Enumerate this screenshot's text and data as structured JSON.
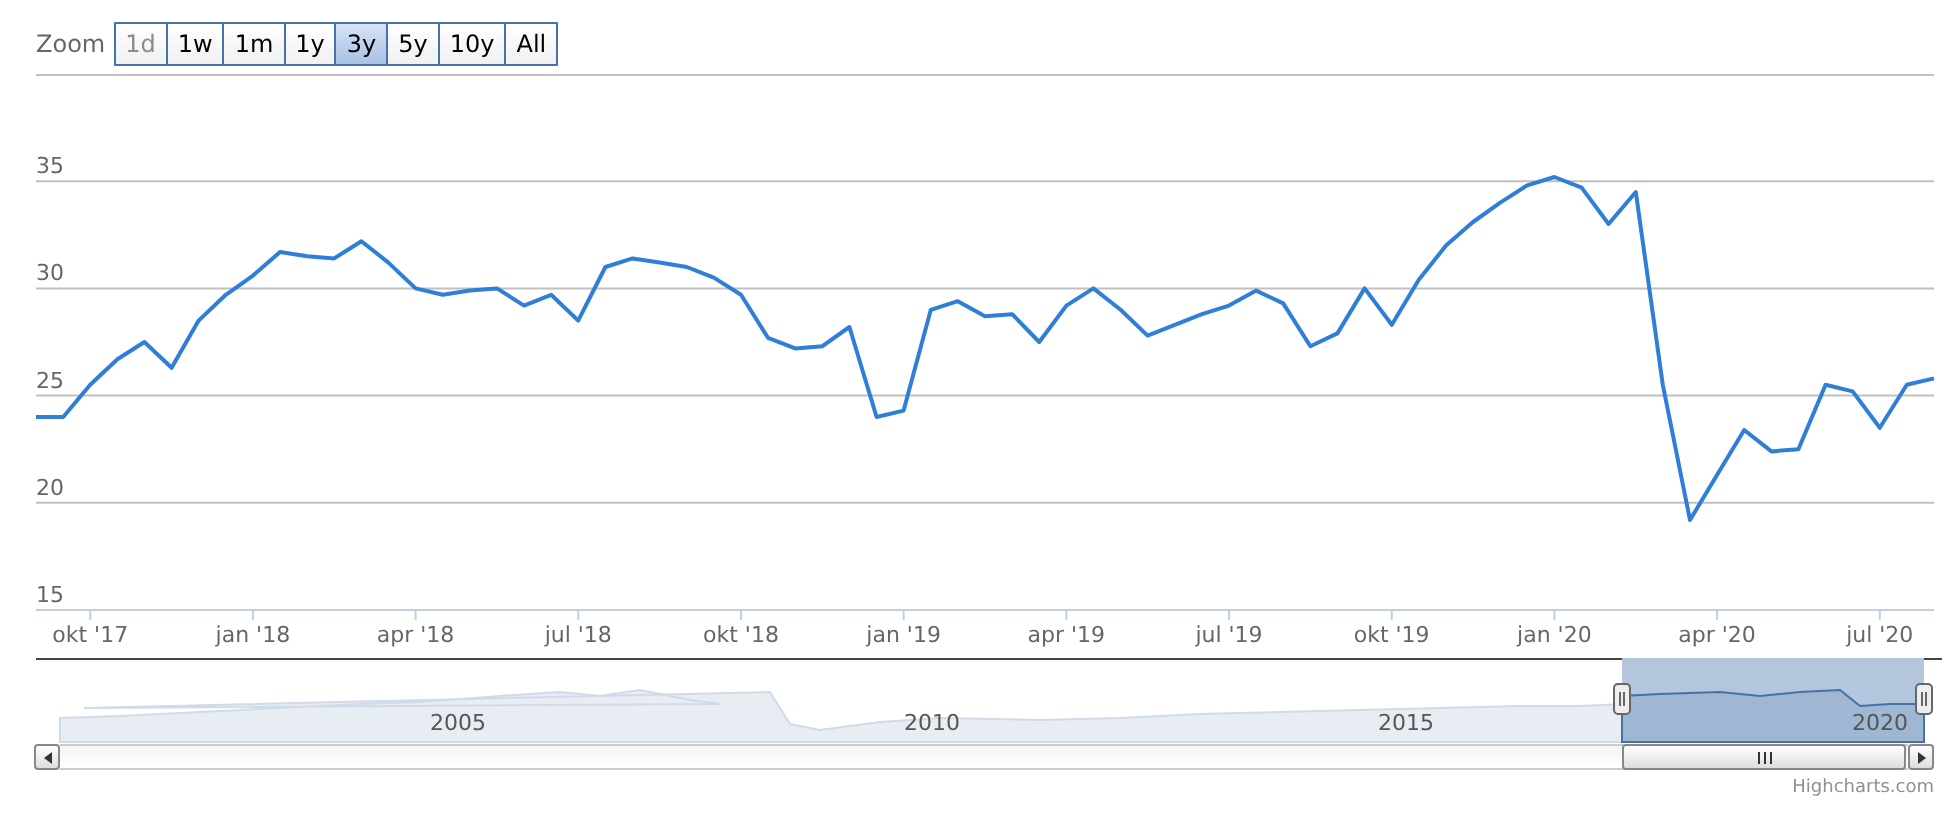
{
  "range_selector": {
    "label": "Zoom",
    "buttons": [
      {
        "label": "1d",
        "selected": false,
        "disabled": true
      },
      {
        "label": "1w",
        "selected": false,
        "disabled": false
      },
      {
        "label": "1m",
        "selected": false,
        "disabled": false
      },
      {
        "label": "1y",
        "selected": false,
        "disabled": false
      },
      {
        "label": "3y",
        "selected": true,
        "disabled": false
      },
      {
        "label": "5y",
        "selected": false,
        "disabled": false
      },
      {
        "label": "10y",
        "selected": false,
        "disabled": false
      },
      {
        "label": "All",
        "selected": false,
        "disabled": false
      }
    ]
  },
  "chart": {
    "chart_data": {
      "type": "line",
      "grid": true,
      "ylim": [
        15,
        40
      ],
      "yticks": [
        15,
        20,
        25,
        30,
        35
      ],
      "categories": [
        null,
        null,
        "okt '17",
        null,
        null,
        null,
        null,
        null,
        "jan '18",
        null,
        null,
        null,
        null,
        null,
        "apr '18",
        null,
        null,
        null,
        null,
        null,
        "jul '18",
        null,
        null,
        null,
        null,
        null,
        "okt '18",
        null,
        null,
        null,
        null,
        null,
        "jan '19",
        null,
        null,
        null,
        null,
        null,
        "apr '19",
        null,
        null,
        null,
        null,
        null,
        "jul '19",
        null,
        null,
        null,
        null,
        null,
        "okt '19",
        null,
        null,
        null,
        null,
        null,
        "jan '20",
        null,
        null,
        null,
        null,
        null,
        "apr '20",
        null,
        null,
        null,
        null,
        null,
        "jul '20",
        null,
        null
      ],
      "series": [
        {
          "color": "#2f7ed8",
          "values": [
            24,
            24,
            25.5,
            26.7,
            27.5,
            26.3,
            28.5,
            29.7,
            30.6,
            31.7,
            31.5,
            31.4,
            32.2,
            31.2,
            30,
            29.7,
            29.9,
            30,
            29.2,
            29.7,
            28.5,
            31,
            31.4,
            31.2,
            31,
            30.5,
            29.7,
            27.7,
            27.2,
            27.3,
            28.2,
            24,
            24.3,
            29,
            29.4,
            28.7,
            28.8,
            27.5,
            29.2,
            30,
            29,
            27.8,
            28.3,
            28.8,
            29.2,
            29.9,
            29.3,
            27.3,
            27.9,
            30,
            28.3,
            30.4,
            32,
            33.1,
            34,
            34.8,
            35.2,
            34.7,
            33,
            34.5,
            25.5,
            19.2,
            21.3,
            23.4,
            22.4,
            22.5,
            25.5,
            25.2,
            23.5,
            25.5,
            25.8
          ]
        }
      ]
    }
  },
  "navigator": {
    "labels": [
      "2005",
      "2010",
      "2015",
      "2020"
    ]
  },
  "credits": "Highcharts.com"
}
